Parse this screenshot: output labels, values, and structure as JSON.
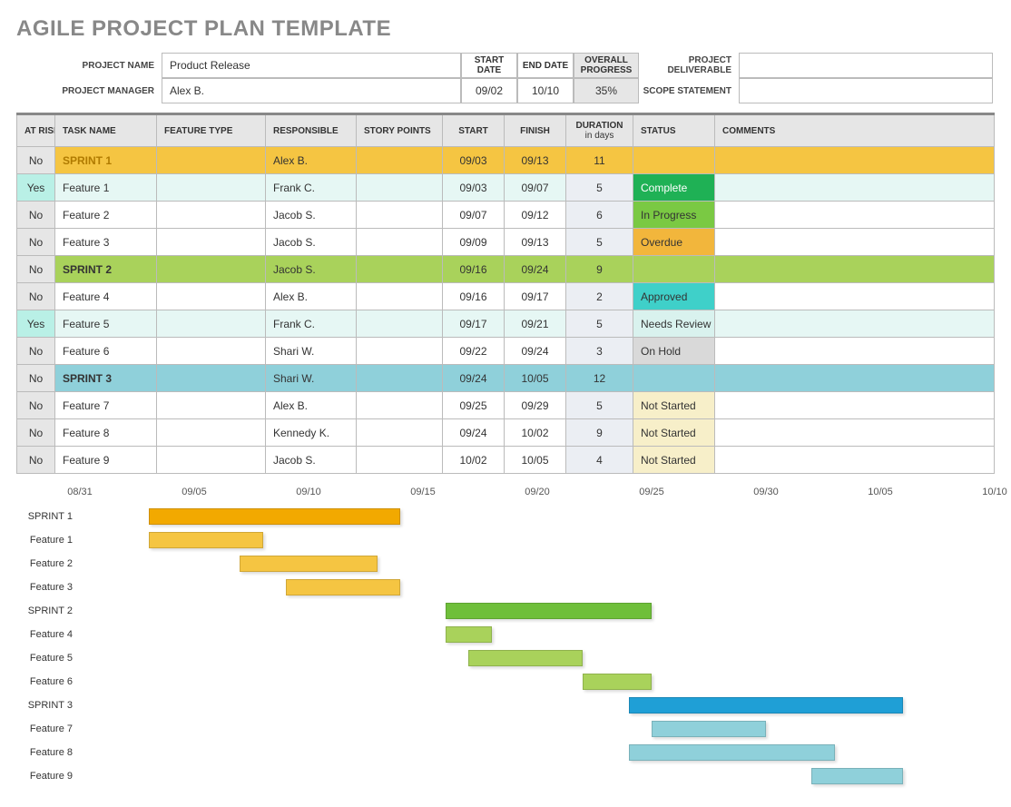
{
  "title": "AGILE PROJECT PLAN TEMPLATE",
  "header": {
    "labels": {
      "project_name": "PROJECT NAME",
      "project_manager": "PROJECT MANAGER",
      "start_date": "START DATE",
      "end_date": "END DATE",
      "overall_progress": "OVERALL PROGRESS",
      "project_deliverable": "PROJECT DELIVERABLE",
      "scope_statement": "SCOPE STATEMENT"
    },
    "project_name": "Product Release",
    "project_manager": "Alex B.",
    "start_date": "09/02",
    "end_date": "10/10",
    "overall_progress": "35%",
    "project_deliverable": "",
    "scope_statement": ""
  },
  "columns": {
    "at_risk": "AT RISK",
    "task_name": "TASK NAME",
    "feature_type": "FEATURE TYPE",
    "responsible": "RESPONSIBLE",
    "story_points": "STORY POINTS",
    "start": "START",
    "finish": "FINISH",
    "duration": "DURATION",
    "duration_sub": "in days",
    "status": "STATUS",
    "comments": "COMMENTS"
  },
  "status_colors": {
    "Complete": "#1fb155",
    "In Progress": "#7ac943",
    "Overdue": "#f2b63c",
    "Approved": "#3fd0c9",
    "Needs Review": "#d9f2ee",
    "On Hold": "#d9d9d9",
    "Not Started": "#f7efc9"
  },
  "sprint_colors": {
    "SPRINT 1": "#f5c542",
    "SPRINT 2": "#a9d25b",
    "SPRINT 3": "#8fd0da"
  },
  "rows": [
    {
      "at_risk": "No",
      "task": "SPRINT 1",
      "feature": "",
      "resp": "Alex B.",
      "story": "",
      "start": "09/03",
      "finish": "09/13",
      "dur": "11",
      "status": "",
      "comments": "",
      "type": "sprint",
      "color": "#f5c542",
      "task_text": "#b07b00"
    },
    {
      "at_risk": "Yes",
      "task": "Feature 1",
      "feature": "",
      "resp": "Frank C.",
      "story": "",
      "start": "09/03",
      "finish": "09/07",
      "dur": "5",
      "status": "Complete",
      "comments": "",
      "type": "task",
      "row_bg": "#e6f7f4"
    },
    {
      "at_risk": "No",
      "task": "Feature 2",
      "feature": "",
      "resp": "Jacob S.",
      "story": "",
      "start": "09/07",
      "finish": "09/12",
      "dur": "6",
      "status": "In Progress",
      "comments": "",
      "type": "task"
    },
    {
      "at_risk": "No",
      "task": "Feature 3",
      "feature": "",
      "resp": "Jacob S.",
      "story": "",
      "start": "09/09",
      "finish": "09/13",
      "dur": "5",
      "status": "Overdue",
      "comments": "",
      "type": "task"
    },
    {
      "at_risk": "No",
      "task": "SPRINT 2",
      "feature": "",
      "resp": "Jacob S.",
      "story": "",
      "start": "09/16",
      "finish": "09/24",
      "dur": "9",
      "status": "",
      "comments": "",
      "type": "sprint",
      "color": "#a9d25b"
    },
    {
      "at_risk": "No",
      "task": "Feature 4",
      "feature": "",
      "resp": "Alex B.",
      "story": "",
      "start": "09/16",
      "finish": "09/17",
      "dur": "2",
      "status": "Approved",
      "comments": "",
      "type": "task"
    },
    {
      "at_risk": "Yes",
      "task": "Feature 5",
      "feature": "",
      "resp": "Frank C.",
      "story": "",
      "start": "09/17",
      "finish": "09/21",
      "dur": "5",
      "status": "Needs Review",
      "comments": "",
      "type": "task",
      "row_bg": "#e6f7f4"
    },
    {
      "at_risk": "No",
      "task": "Feature 6",
      "feature": "",
      "resp": "Shari W.",
      "story": "",
      "start": "09/22",
      "finish": "09/24",
      "dur": "3",
      "status": "On Hold",
      "comments": "",
      "type": "task"
    },
    {
      "at_risk": "No",
      "task": "SPRINT 3",
      "feature": "",
      "resp": "Shari W.",
      "story": "",
      "start": "09/24",
      "finish": "10/05",
      "dur": "12",
      "status": "",
      "comments": "",
      "type": "sprint",
      "color": "#8fd0da"
    },
    {
      "at_risk": "No",
      "task": "Feature 7",
      "feature": "",
      "resp": "Alex B.",
      "story": "",
      "start": "09/25",
      "finish": "09/29",
      "dur": "5",
      "status": "Not Started",
      "comments": "",
      "type": "task"
    },
    {
      "at_risk": "No",
      "task": "Feature 8",
      "feature": "",
      "resp": "Kennedy K.",
      "story": "",
      "start": "09/24",
      "finish": "10/02",
      "dur": "9",
      "status": "Not Started",
      "comments": "",
      "type": "task"
    },
    {
      "at_risk": "No",
      "task": "Feature 9",
      "feature": "",
      "resp": "Jacob S.",
      "story": "",
      "start": "10/02",
      "finish": "10/05",
      "dur": "4",
      "status": "Not Started",
      "comments": "",
      "type": "task"
    }
  ],
  "chart_data": {
    "type": "bar",
    "title": "",
    "xlabel": "",
    "ylabel": "",
    "x_axis_ticks": [
      "08/31",
      "09/05",
      "09/10",
      "09/15",
      "09/20",
      "09/25",
      "09/30",
      "10/05",
      "10/10"
    ],
    "x_range_days": [
      "08/31",
      "10/10"
    ],
    "categories": [
      "SPRINT 1",
      "Feature 1",
      "Feature 2",
      "Feature 3",
      "SPRINT 2",
      "Feature 4",
      "Feature 5",
      "Feature 6",
      "SPRINT 3",
      "Feature 7",
      "Feature 8",
      "Feature 9"
    ],
    "bars": [
      {
        "name": "SPRINT 1",
        "start": "09/03",
        "finish": "09/14",
        "color": "#f2a900"
      },
      {
        "name": "Feature 1",
        "start": "09/03",
        "finish": "09/08",
        "color": "#f5c542"
      },
      {
        "name": "Feature 2",
        "start": "09/07",
        "finish": "09/13",
        "color": "#f5c542"
      },
      {
        "name": "Feature 3",
        "start": "09/09",
        "finish": "09/14",
        "color": "#f5c542"
      },
      {
        "name": "SPRINT 2",
        "start": "09/16",
        "finish": "09/25",
        "color": "#6fbf3a"
      },
      {
        "name": "Feature 4",
        "start": "09/16",
        "finish": "09/18",
        "color": "#a9d25b"
      },
      {
        "name": "Feature 5",
        "start": "09/17",
        "finish": "09/22",
        "color": "#a9d25b"
      },
      {
        "name": "Feature 6",
        "start": "09/22",
        "finish": "09/25",
        "color": "#a9d25b"
      },
      {
        "name": "SPRINT 3",
        "start": "09/24",
        "finish": "10/06",
        "color": "#1f9fd6"
      },
      {
        "name": "Feature 7",
        "start": "09/25",
        "finish": "09/30",
        "color": "#8fd0da"
      },
      {
        "name": "Feature 8",
        "start": "09/24",
        "finish": "10/03",
        "color": "#8fd0da"
      },
      {
        "name": "Feature 9",
        "start": "10/02",
        "finish": "10/06",
        "color": "#8fd0da"
      }
    ]
  }
}
